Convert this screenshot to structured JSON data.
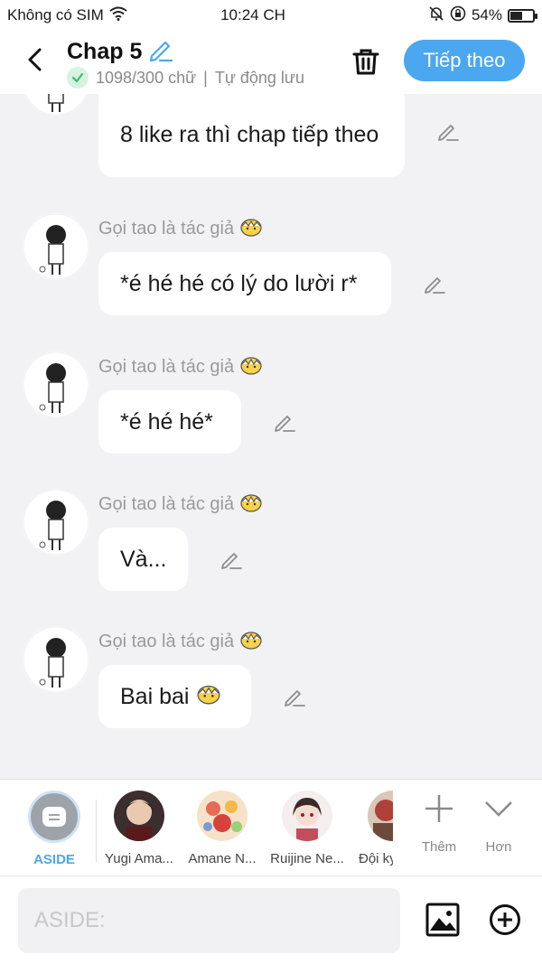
{
  "status_bar": {
    "carrier": "Không có SIM",
    "time": "10:24 CH",
    "battery": "54%",
    "battery_level": 0.54
  },
  "header": {
    "title": "Chap 5",
    "word_count": "1098/300 chữ",
    "autosave": "Tự động lưu",
    "next_label": "Tiếp theo"
  },
  "messages": [
    {
      "author": "",
      "text": "8 like ra thì chap tiếp theo"
    },
    {
      "author": "Gọi tao là tác giả",
      "text": "*é hé hé có lý do lười r*"
    },
    {
      "author": "Gọi tao là tác giả",
      "text": "*é hé hé*"
    },
    {
      "author": "Gọi tao là tác giả",
      "text": "Và..."
    },
    {
      "author": "Gọi tao là tác giả",
      "text": "Bai bai"
    }
  ],
  "characters": {
    "aside_label": "ASIDE",
    "items": [
      {
        "name": "Yugi Ama..."
      },
      {
        "name": "Amane N..."
      },
      {
        "name": "Ruijine Ne..."
      },
      {
        "name": "Đội kỵ"
      }
    ],
    "more_label": "Thêm",
    "collapse_label": "Hơn"
  },
  "input": {
    "placeholder": "ASIDE:"
  },
  "colors": {
    "accent": "#4ba7f0",
    "background": "#f2f2f4"
  }
}
